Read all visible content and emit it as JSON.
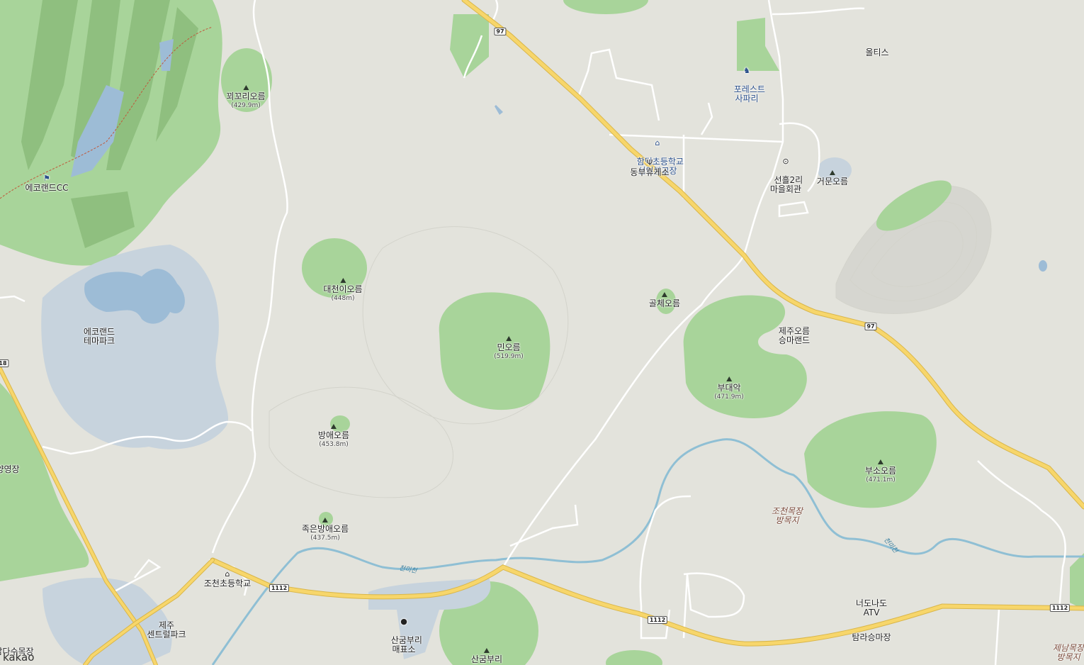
{
  "brand": "kakao",
  "colors": {
    "background": "#e3e3dc",
    "park": "#a8d49a",
    "water": "#c7d3dd",
    "lake": "#9dbcd6",
    "road_major": "#f7d66b",
    "road_outline": "#d9b64a",
    "stream": "#8fbfd4",
    "road_minor": "#ffffff"
  },
  "routes": {
    "r97_a": "97",
    "r97_b": "97",
    "r1112_a": "1112",
    "r1112_b": "1112",
    "r1112_c": "1112",
    "r1112_d": "1112",
    "r18": "18"
  },
  "peaks": {
    "kkwokkori": {
      "name": "꾀꼬리오름",
      "elev": "(429.9m)"
    },
    "daecheoni": {
      "name": "대천이오름",
      "elev": "(448m)"
    },
    "min": {
      "name": "민오름",
      "elev": "(519.9m)"
    },
    "bangae": {
      "name": "방애오름",
      "elev": "(453.8m)"
    },
    "jogeun": {
      "name": "족은방애오름",
      "elev": "(437.5m)"
    },
    "golche": {
      "name": "골체오름"
    },
    "budae": {
      "name": "부대악",
      "elev": "(471.9m)"
    },
    "buso": {
      "name": "부소오름",
      "elev": "(471.1m)"
    },
    "geomun": {
      "name": "거문오름"
    },
    "sangumburi": {
      "name": "산굼부리"
    }
  },
  "places": {
    "ecoland_cc": "에코랜드CC",
    "ecoland_theme": "에코랜드\n테마파크",
    "forest_safari": "포레스트\n사파리",
    "oltis": "올티스",
    "hamdeok_school": "함덕초등학교\n선인분교장",
    "dongbu_rest": "동부휴게소",
    "seonheul_hall": "선흘2리\n마을회관",
    "jeju_oreum_horse": "제주오름\n승마랜드",
    "jocheon_ranch": "조천목장\n방목지",
    "neodonado_atv": "너도나도\nATV",
    "tamra_horse": "탐라승마장",
    "jocheon_school": "조천초등학교",
    "sangumburi_store": "산굼부리\n매표소",
    "jeju_central_park": "제주\n센트럴파크",
    "yangyeongjang": "양영장",
    "dasu_ranch": "남다수목장",
    "jenam_ranch": "제남목장\n방목지"
  },
  "streams": {
    "cheonmi_a": "천미천",
    "cheonmi_b": "천미천"
  }
}
